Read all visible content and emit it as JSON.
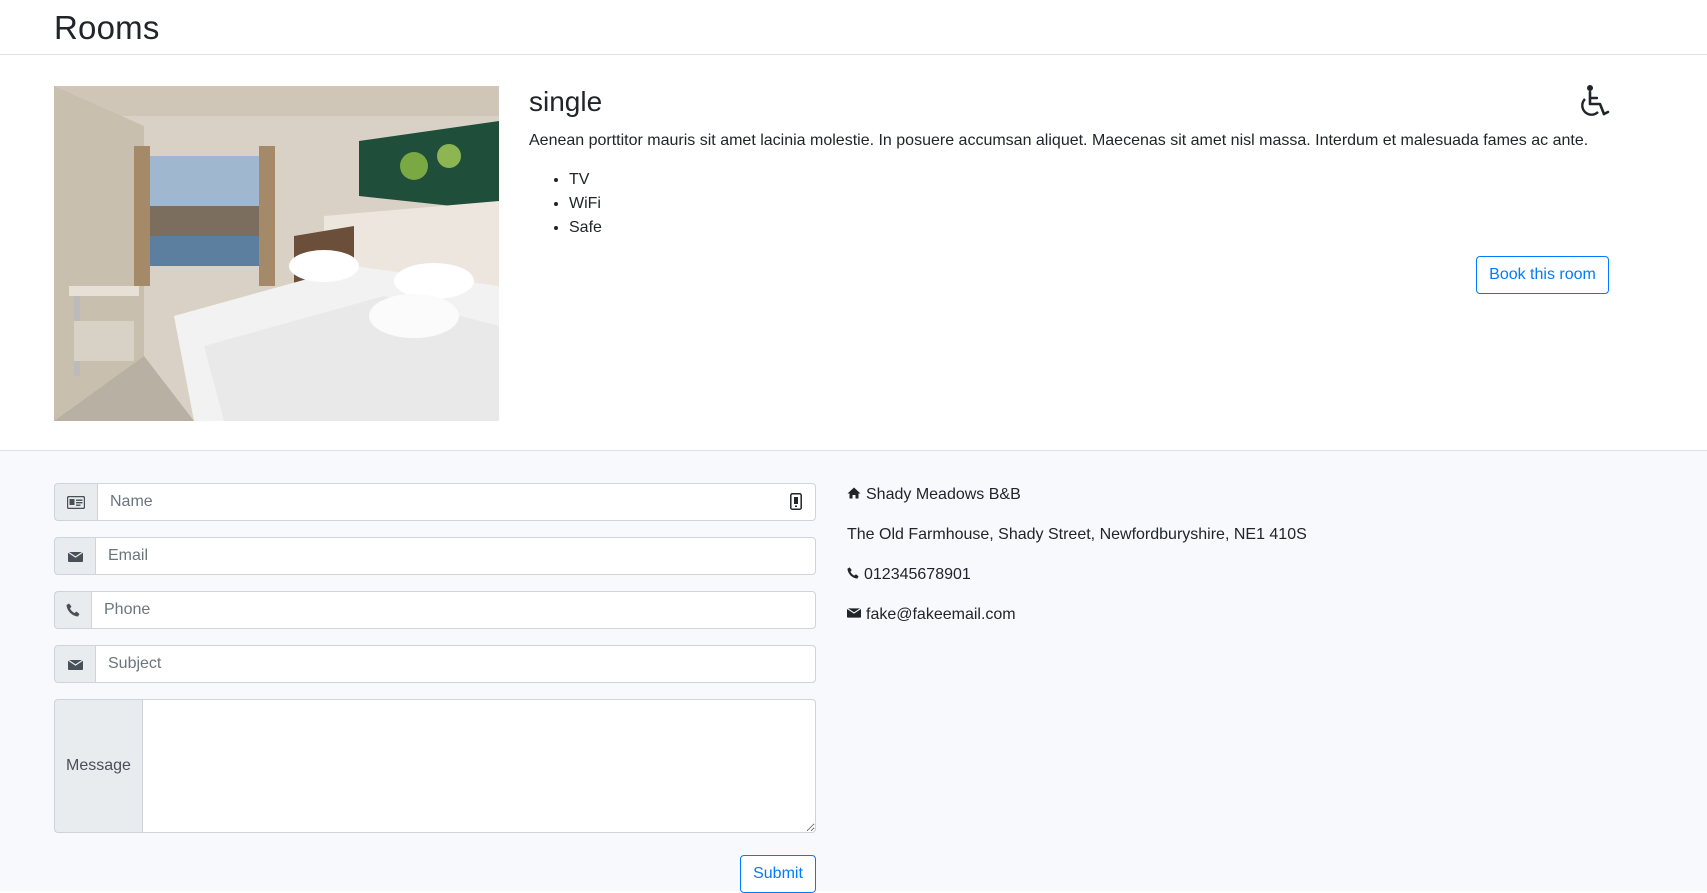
{
  "header": {
    "title": "Rooms"
  },
  "room": {
    "type": "single",
    "description": "Aenean porttitor mauris sit amet lacinia molestie. In posuere accumsan aliquet. Maecenas sit amet nisl massa. Interdum et malesuada fames ac ante.",
    "features": [
      "TV",
      "WiFi",
      "Safe"
    ],
    "accessible_icon": "wheelchair-icon",
    "book_label": "Book this room"
  },
  "contact_form": {
    "name_placeholder": "Name",
    "email_placeholder": "Email",
    "phone_placeholder": "Phone",
    "subject_placeholder": "Subject",
    "message_label": "Message",
    "submit_label": "Submit"
  },
  "contact_info": {
    "name": "Shady Meadows B&B",
    "address": "The Old Farmhouse, Shady Street, Newfordburyshire, NE1 410S",
    "phone": "012345678901",
    "email": "fake@fakeemail.com"
  },
  "colors": {
    "accent": "#007bff",
    "addon_bg": "#e9ecef",
    "section_bg": "#f7f9fc"
  }
}
